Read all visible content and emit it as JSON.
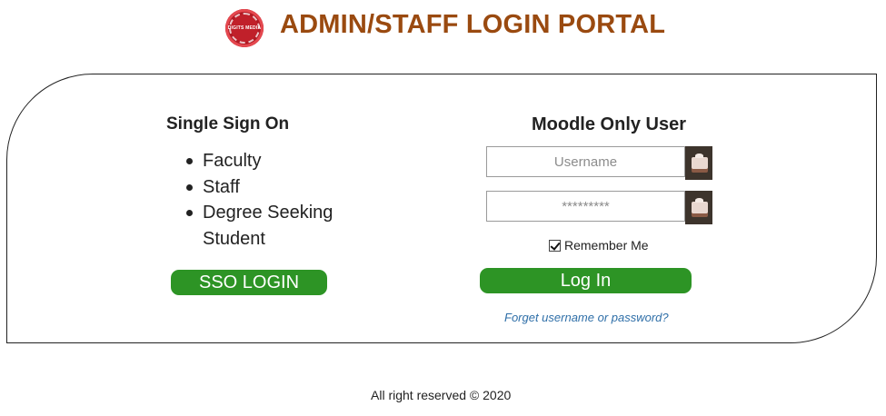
{
  "header": {
    "logo_text": "DIGITS MEDIA",
    "title": "ADMIN/STAFF LOGIN PORTAL",
    "title_color": "#9a4a10"
  },
  "sso": {
    "heading": "Single Sign On",
    "items": [
      "Faculty",
      "Staff",
      "Degree Seeking Student"
    ],
    "button_label": "SSO LOGIN"
  },
  "moodle": {
    "heading": "Moodle Only User",
    "username": {
      "placeholder": "Username",
      "value": ""
    },
    "password": {
      "placeholder": "*********",
      "value": ""
    },
    "remember_label": "Remember Me",
    "remember_checked": true,
    "login_label": "Log In",
    "forgot_label": "Forget username or password?"
  },
  "footer": {
    "text": "All right reserved © 2020"
  },
  "colors": {
    "button_green": "#2d9425",
    "link_blue": "#2f6fa8"
  }
}
